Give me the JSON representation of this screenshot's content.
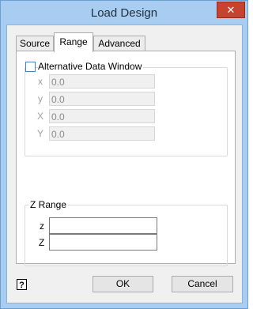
{
  "window": {
    "title": "Load Design",
    "close_glyph": "✕"
  },
  "tabs": [
    {
      "label": "Source"
    },
    {
      "label": "Range"
    },
    {
      "label": "Advanced"
    }
  ],
  "alt_window": {
    "checkbox_label": "Alternative Data Window",
    "checked": false,
    "fields": [
      {
        "label": "x",
        "value": "0.0"
      },
      {
        "label": "y",
        "value": "0.0"
      },
      {
        "label": "X",
        "value": "0.0"
      },
      {
        "label": "Y",
        "value": "0.0"
      }
    ]
  },
  "z_range": {
    "title": "Z Range",
    "fields": [
      {
        "label": "z",
        "value": ""
      },
      {
        "label": "Z",
        "value": ""
      }
    ]
  },
  "buttons": {
    "ok": "OK",
    "cancel": "Cancel"
  },
  "help": {
    "glyph": "?",
    "icon": "help-icon"
  }
}
